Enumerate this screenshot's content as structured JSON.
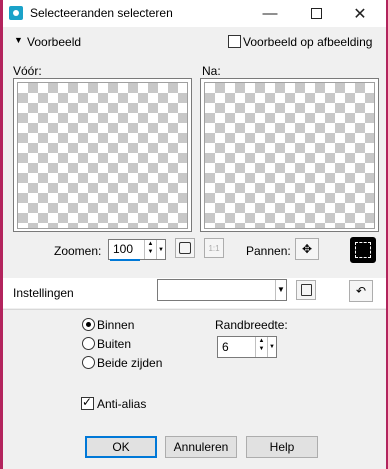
{
  "window": {
    "title": "Selecteeranden selecteren",
    "min_glyph": "—",
    "close_glyph": "✕"
  },
  "preview_header": {
    "label": "Voorbeeld",
    "toggle_glyph": "▼",
    "image_checkbox_label": "Voorbeeld op afbeelding",
    "image_checkbox_checked": false
  },
  "before_label": "Vóór:",
  "after_label": "Na:",
  "zoom": {
    "label": "Zoomen:",
    "value": "100",
    "pan_label": "Pannen:"
  },
  "settings": {
    "label": "Instellingen",
    "selected": ""
  },
  "options": {
    "radios": [
      {
        "label": "Binnen",
        "selected": true
      },
      {
        "label": "Buiten",
        "selected": false
      },
      {
        "label": "Beide zijden",
        "selected": false
      }
    ],
    "border_width_label": "Randbreedte:",
    "border_width_value": "6",
    "antialias_label": "Anti-alias",
    "antialias_checked": true
  },
  "buttons": {
    "ok": "OK",
    "cancel": "Annuleren",
    "help": "Help"
  },
  "colors": {
    "accent": "#0078d7",
    "edge": "#b3245d"
  }
}
